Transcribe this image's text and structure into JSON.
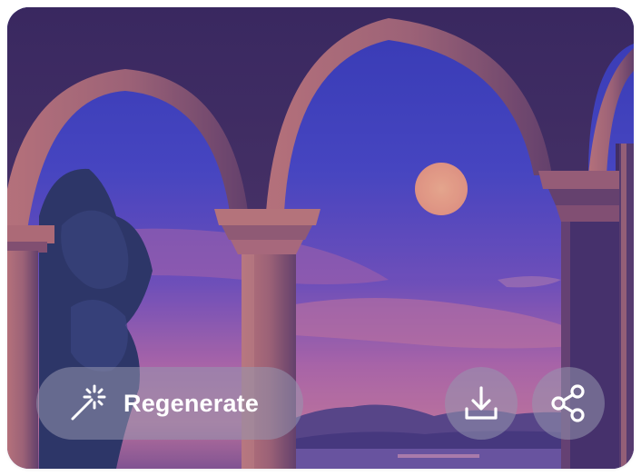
{
  "image_card": {
    "image": {
      "semantic": "arched-colonnade-moonlit-lake-artwork"
    },
    "actions": {
      "regenerate": {
        "label": "Regenerate",
        "icon": "magic-wand-icon"
      },
      "download": {
        "icon": "download-icon"
      },
      "share": {
        "icon": "share-icon"
      }
    }
  },
  "colors": {
    "sky_top": "#3f47c9",
    "sky_mid": "#6a55c8",
    "horizon": "#c97aa8",
    "moon": "#f3a788",
    "arch_light": "#b8727e",
    "arch_shadow": "#3a2a5e",
    "button_glass": "#9696af"
  }
}
